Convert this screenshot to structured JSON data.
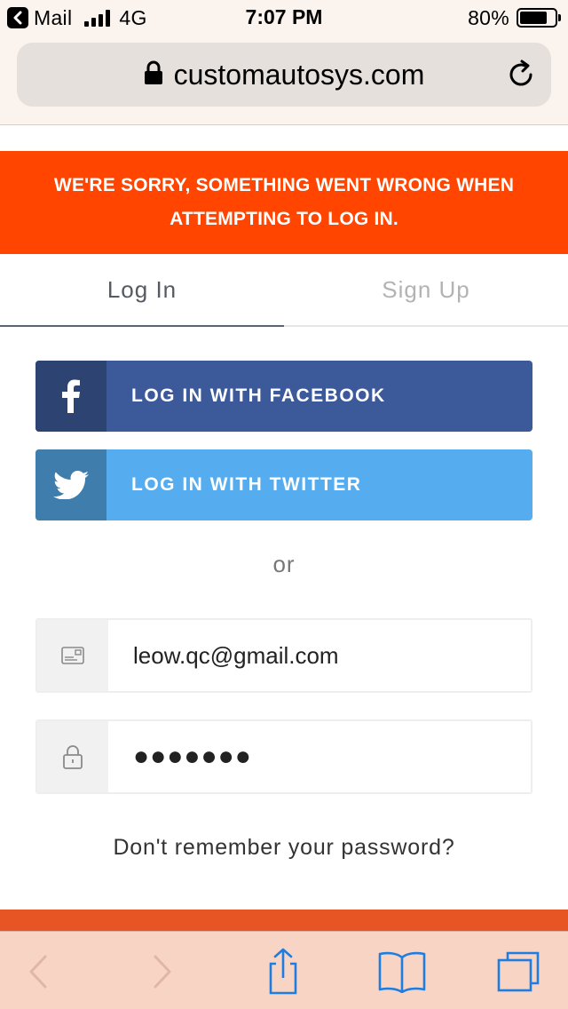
{
  "status_bar": {
    "back_app_label": "Mail",
    "network": "4G",
    "time": "7:07 PM",
    "battery_percent_label": "80%",
    "battery_level": 0.8
  },
  "browser": {
    "url": "customautosys.com",
    "icons": {
      "lock": "lock-icon",
      "reload": "reload-icon",
      "back": "back-arrow-icon",
      "forward": "forward-arrow-icon",
      "share": "share-icon",
      "bookmarks": "bookmarks-icon",
      "tabs": "tabs-icon"
    },
    "tint_color": "#1e7de0",
    "disabled_color": "#e0b6a6"
  },
  "error_banner": {
    "message": "WE'RE SORRY, SOMETHING WENT WRONG WHEN ATTEMPTING TO LOG IN.",
    "color": "#ff4500"
  },
  "tabs": [
    {
      "label": "Log In",
      "active": true
    },
    {
      "label": "Sign Up",
      "active": false
    }
  ],
  "social": {
    "facebook_label": "LOG IN WITH FACEBOOK",
    "twitter_label": "LOG IN WITH TWITTER",
    "facebook_color": "#3c5a99",
    "twitter_color": "#55acee"
  },
  "or_text": "or",
  "form": {
    "email_value": "leow.qc@gmail.com",
    "password_masked": "●●●●●●●"
  },
  "forgot_password": "Don't remember your password?"
}
